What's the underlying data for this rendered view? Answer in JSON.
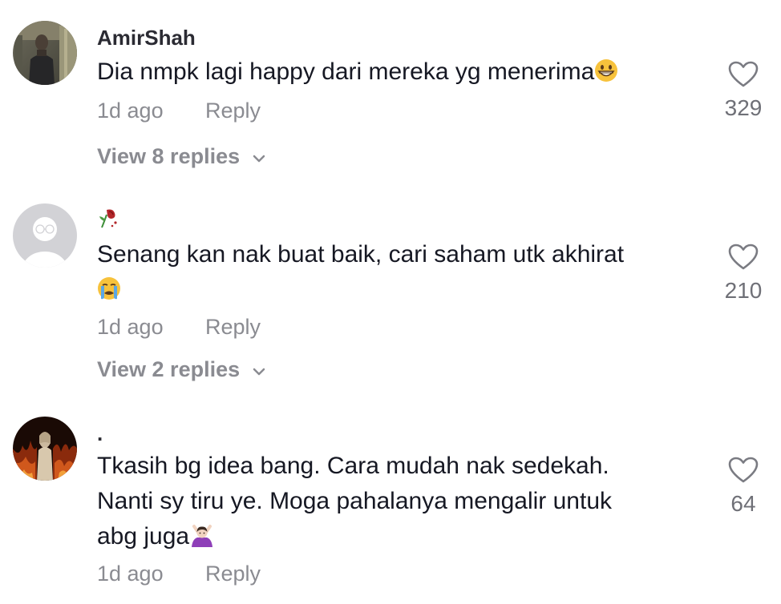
{
  "comments": [
    {
      "username": "AmirShah",
      "text": "Dia nmpk lagi happy dari mereka yg menerima",
      "emoji": "grinning-face-emoji",
      "time": "1d ago",
      "reply_label": "Reply",
      "likes": "329",
      "view_replies": "View 8 replies"
    },
    {
      "username_emoji": "wilted-rose-emoji",
      "text": "Senang kan nak buat baik, cari saham utk akhirat",
      "emoji": "crying-face-emoji",
      "time": "1d ago",
      "reply_label": "Reply",
      "likes": "210",
      "view_replies": "View 2 replies"
    },
    {
      "username": ".",
      "text_line1": "Tkasih bg idea bang. Cara mudah nak sedekah.",
      "text_line2": "Nanti sy tiru ye. Moga pahalanya mengalir untuk",
      "text_line3": "abg juga",
      "emoji": "person-gesturing-no-emoji",
      "time": "1d ago",
      "reply_label": "Reply",
      "likes": "64"
    }
  ],
  "colors": {
    "primary_text": "#161823",
    "secondary_text": "#8a8b91",
    "like_count": "#6f7077"
  }
}
